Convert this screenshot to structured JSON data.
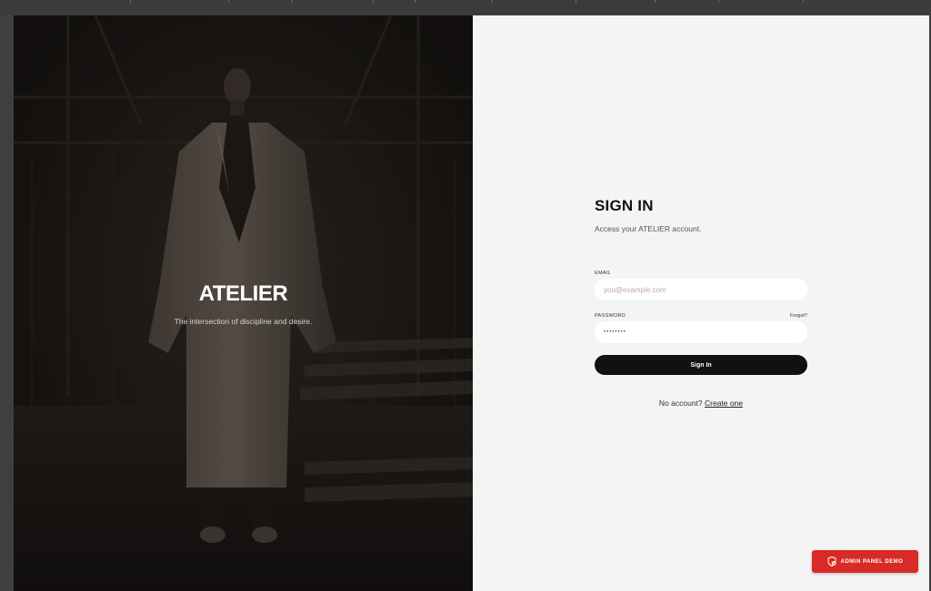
{
  "hero": {
    "brand": "ATELIER",
    "tagline": "The intersection of discipline and desire."
  },
  "signin": {
    "title": "SIGN IN",
    "subtitle": "Access your ATELIER account.",
    "email_label": "EMAIL",
    "email_placeholder": "you@example.com",
    "password_label": "PASSWORD",
    "forgot_label": "Forgot?",
    "password_value": "••••••••",
    "submit_label": "Sign In",
    "no_account_text": "No account?",
    "create_link": "Create one"
  },
  "admin_demo": {
    "label": "ADMIN PANEL DEMO",
    "icon": "shield-lock-icon"
  },
  "colors": {
    "panel_bg": "#f4f4f4",
    "button_dark": "#111111",
    "accent_red": "#d92b25"
  }
}
